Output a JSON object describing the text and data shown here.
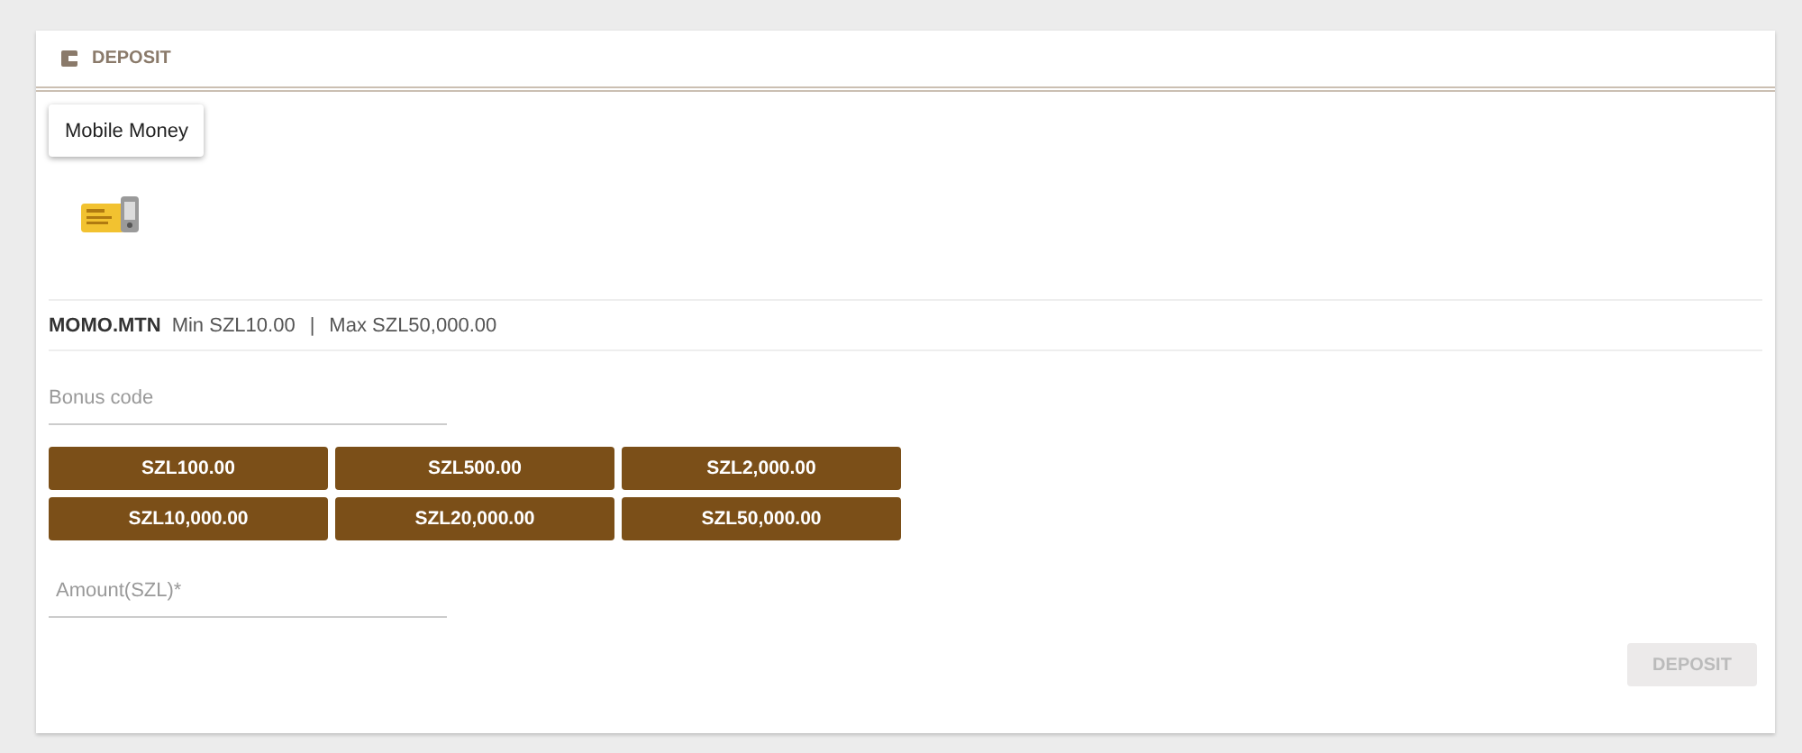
{
  "header": {
    "title": "DEPOSIT"
  },
  "method_tabs": [
    {
      "label": "Mobile Money",
      "selected": true
    }
  ],
  "method": {
    "name": "MOMO.MTN",
    "min": "Min SZL10.00",
    "separator": "|",
    "max": "Max SZL50,000.00"
  },
  "bonus_field": {
    "placeholder": "Bonus code"
  },
  "amount_buttons": [
    "SZL100.00",
    "SZL500.00",
    "SZL2,000.00",
    "SZL10,000.00",
    "SZL20,000.00",
    "SZL50,000.00"
  ],
  "amount_field": {
    "placeholder": "Amount(SZL)*"
  },
  "submit": {
    "label": "DEPOSIT",
    "disabled": true
  }
}
